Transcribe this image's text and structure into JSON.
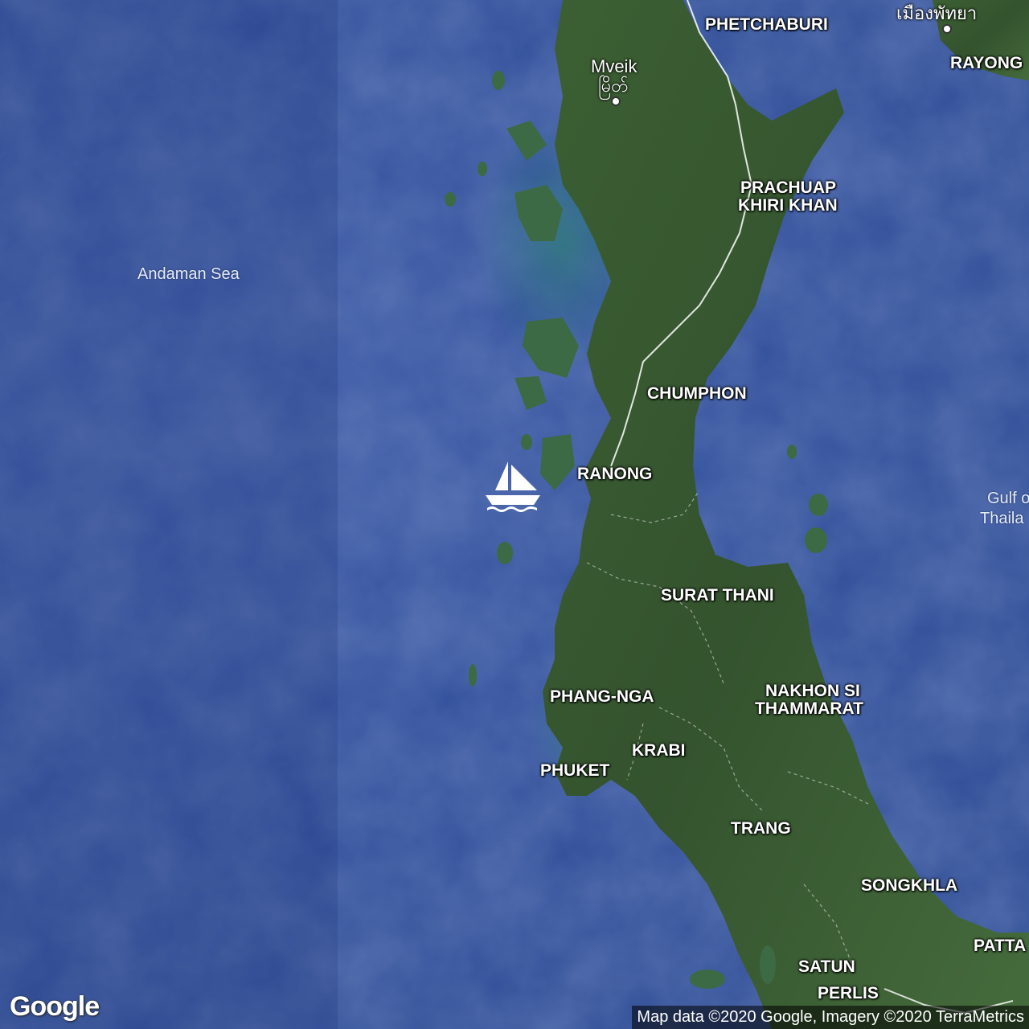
{
  "map": {
    "sea_labels": {
      "andaman": "Andaman Sea",
      "gulf_line1": "Gulf o",
      "gulf_line2": "Thaila"
    },
    "cities": {
      "mveik_en": "Mveik",
      "mveik_local": "မြိတ်",
      "pattaya_local": "เมืองพัทยา"
    },
    "provinces": {
      "phetchaburi": "PHETCHABURI",
      "rayong": "RAYONG",
      "prachuap_1": "PRACHUAP",
      "prachuap_2": "KHIRI KHAN",
      "chumphon": "CHUMPHON",
      "ranong": "RANONG",
      "surat_thani": "SURAT THANI",
      "phang_nga": "PHANG-NGA",
      "nakhon_1": "NAKHON SI",
      "nakhon_2": "THAMMARAT",
      "krabi": "KRABI",
      "phuket": "PHUKET",
      "trang": "TRANG",
      "songkhla": "SONGKHLA",
      "pattani": "PATTA",
      "satun": "SATUN",
      "perlis": "PERLIS"
    },
    "marker": {
      "icon": "sailboat-icon",
      "color": "#ffffff"
    },
    "colors": {
      "sea": "#32509c",
      "land": "#3a5a35",
      "border": "#ffffff"
    }
  },
  "branding": {
    "logo_text": "Google"
  },
  "attribution": {
    "text": "Map data ©2020 Google, Imagery ©2020 TerraMetrics"
  }
}
